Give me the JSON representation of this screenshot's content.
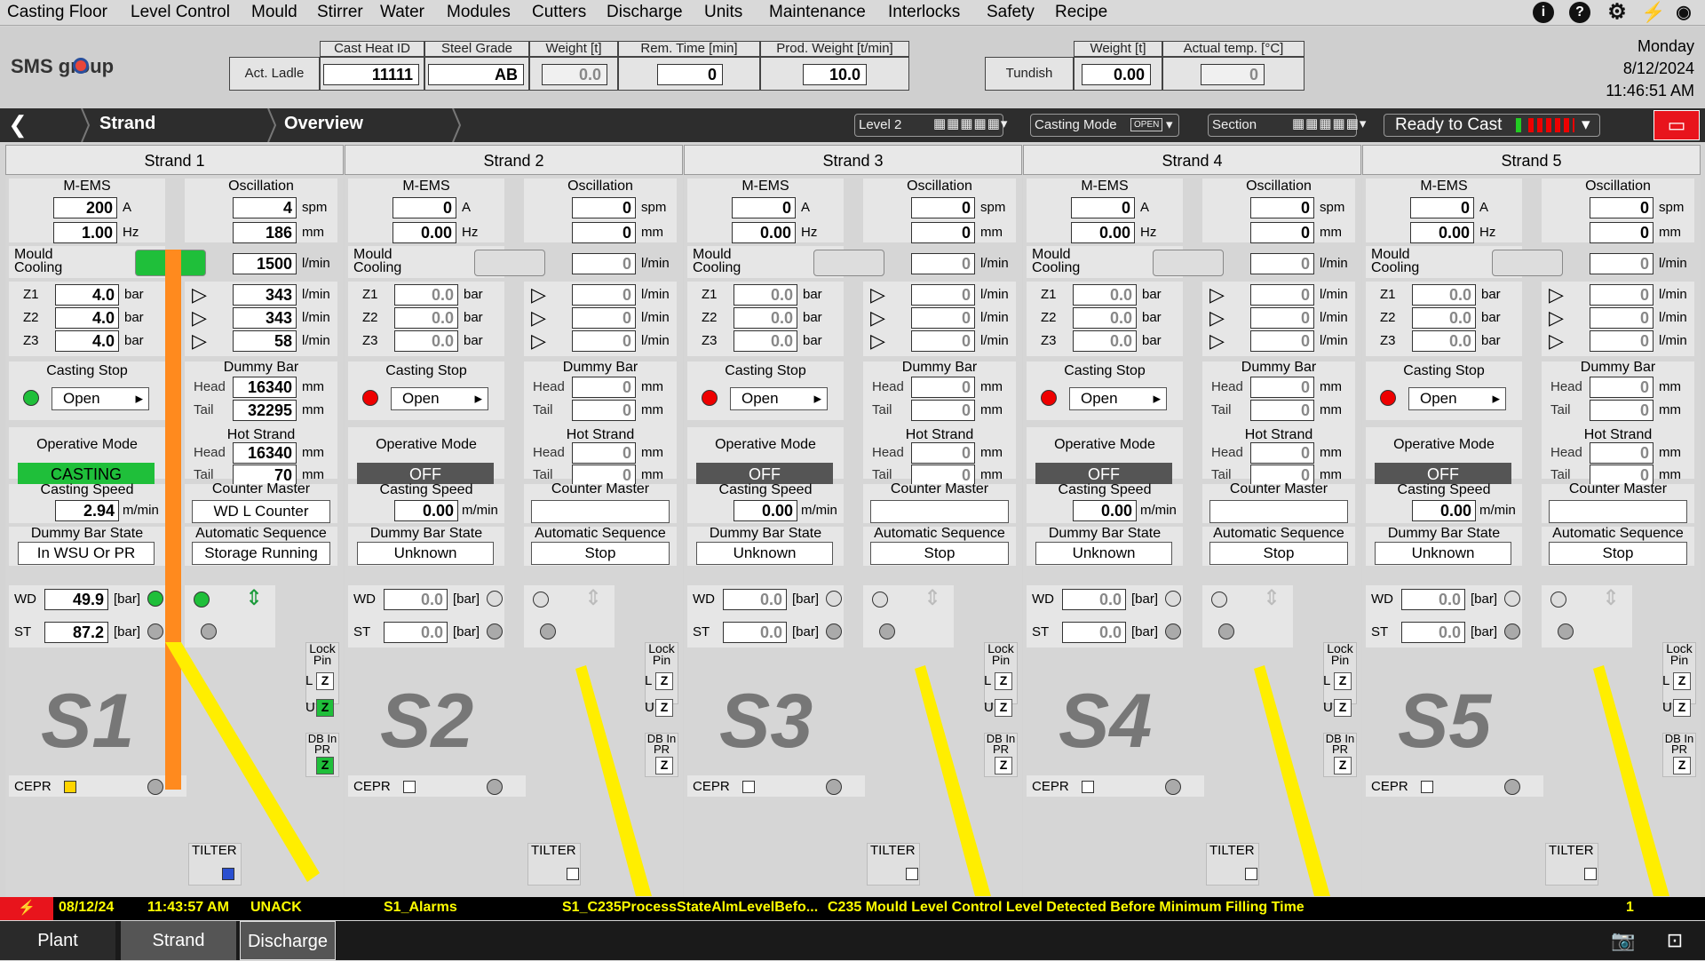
{
  "menu": [
    "Casting Floor",
    "Level Control",
    "Mould",
    "Stirrer",
    "Water",
    "Modules",
    "Cutters",
    "Discharge",
    "Units",
    "Maintenance",
    "Interlocks",
    "Safety",
    "Recipe"
  ],
  "logo": "SMS group",
  "ladle": {
    "row_label": "Act. Ladle",
    "h_heat": "Cast Heat ID",
    "h_grade": "Steel Grade",
    "h_weight": "Weight [t]",
    "h_rem": "Rem. Time [min]",
    "h_prod": "Prod. Weight [t/min]",
    "heat": "11111",
    "grade": "AB",
    "weight": "0.0",
    "rem": "0",
    "prod": "10.0"
  },
  "tundish": {
    "row_label": "Tundish",
    "h_weight": "Weight [t]",
    "h_temp": "Actual temp. [°C]",
    "weight": "0.00",
    "temp": "0"
  },
  "clock": {
    "day": "Monday",
    "date": "8/12/2024",
    "time": "11:46:51 AM"
  },
  "nav": {
    "strand": "Strand",
    "overview": "Overview",
    "level": "Level 2",
    "casting_mode": "Casting Mode",
    "open_badge": "OPEN",
    "section": "Section",
    "ready": "Ready to Cast"
  },
  "labels": {
    "mems": "M-EMS",
    "osc": "Oscillation",
    "mould_cooling": "Mould Cooling",
    "casting_stop": "Casting Stop",
    "dummy_bar": "Dummy Bar",
    "hot_strand": "Hot Strand",
    "head": "Head",
    "tail": "Tail",
    "operative_mode": "Operative Mode",
    "casting_speed": "Casting Speed",
    "counter_master": "Counter Master",
    "db_state": "Dummy Bar State",
    "auto_seq": "Automatic Sequence",
    "wd": "WD",
    "st": "ST",
    "cepr": "CEPR",
    "tilter": "TILTER",
    "lock_pin": "Lock Pin",
    "db_in_pr": "DB In PR",
    "u_a": "A",
    "u_hz": "Hz",
    "u_spm": "spm",
    "u_mm": "mm",
    "u_lmin": "l/min",
    "u_bar": "bar",
    "u_bbar": "[bar]",
    "u_mmin": "m/min",
    "z1": "Z1",
    "z2": "Z2",
    "z3": "Z3",
    "l": "L",
    "u": "U"
  },
  "strands": [
    {
      "name": "Strand 1",
      "big": "S1",
      "mems_a": "200",
      "mems_hz": "1.00",
      "osc_spm": "4",
      "osc_mm": "186",
      "mould_flow": "1500",
      "z1": "4.0",
      "z2": "4.0",
      "z3": "4.0",
      "z1f": "343",
      "z2f": "343",
      "z3f": "58",
      "stop": "Open",
      "db_head": "16340",
      "db_tail": "32295",
      "hs_head": "16340",
      "hs_tail": "70",
      "mode": "CASTING",
      "speed": "2.94",
      "counter": "WD L Counter",
      "db_state": "In WSU Or PR",
      "seq": "Storage Running",
      "wd": "49.9",
      "st": "87.2"
    },
    {
      "name": "Strand 2",
      "big": "S2",
      "mems_a": "0",
      "mems_hz": "0.00",
      "osc_spm": "0",
      "osc_mm": "0",
      "mould_flow": "0",
      "z1": "0.0",
      "z2": "0.0",
      "z3": "0.0",
      "z1f": "0",
      "z2f": "0",
      "z3f": "0",
      "stop": "Open",
      "db_head": "0",
      "db_tail": "0",
      "hs_head": "0",
      "hs_tail": "0",
      "mode": "OFF",
      "speed": "0.00",
      "counter": "",
      "db_state": "Unknown",
      "seq": "Stop",
      "wd": "0.0",
      "st": "0.0"
    },
    {
      "name": "Strand 3",
      "big": "S3",
      "mems_a": "0",
      "mems_hz": "0.00",
      "osc_spm": "0",
      "osc_mm": "0",
      "mould_flow": "0",
      "z1": "0.0",
      "z2": "0.0",
      "z3": "0.0",
      "z1f": "0",
      "z2f": "0",
      "z3f": "0",
      "stop": "Open",
      "db_head": "0",
      "db_tail": "0",
      "hs_head": "0",
      "hs_tail": "0",
      "mode": "OFF",
      "speed": "0.00",
      "counter": "",
      "db_state": "Unknown",
      "seq": "Stop",
      "wd": "0.0",
      "st": "0.0"
    },
    {
      "name": "Strand 4",
      "big": "S4",
      "mems_a": "0",
      "mems_hz": "0.00",
      "osc_spm": "0",
      "osc_mm": "0",
      "mould_flow": "0",
      "z1": "0.0",
      "z2": "0.0",
      "z3": "0.0",
      "z1f": "0",
      "z2f": "0",
      "z3f": "0",
      "stop": "Open",
      "db_head": "0",
      "db_tail": "0",
      "hs_head": "0",
      "hs_tail": "0",
      "mode": "OFF",
      "speed": "0.00",
      "counter": "",
      "db_state": "Unknown",
      "seq": "Stop",
      "wd": "0.0",
      "st": "0.0"
    },
    {
      "name": "Strand 5",
      "big": "S5",
      "mems_a": "0",
      "mems_hz": "0.00",
      "osc_spm": "0",
      "osc_mm": "0",
      "mould_flow": "0",
      "z1": "0.0",
      "z2": "0.0",
      "z3": "0.0",
      "z1f": "0",
      "z2f": "0",
      "z3f": "0",
      "stop": "Open",
      "db_head": "0",
      "db_tail": "0",
      "hs_head": "0",
      "hs_tail": "0",
      "mode": "OFF",
      "speed": "0.00",
      "counter": "",
      "db_state": "Unknown",
      "seq": "Stop",
      "wd": "0.0",
      "st": "0.0"
    }
  ],
  "alarm": {
    "date": "08/12/24",
    "time": "11:43:57 AM",
    "state": "UNACK",
    "group": "S1_Alarms",
    "tag": "S1_C235ProcessStateAlmLevelBefo...",
    "text": "C235 Mould Level Control Level Detected Before Minimum Filling Time",
    "count": "1"
  },
  "tabs": [
    "Plant",
    "Strand",
    "Discharge"
  ],
  "colors": {
    "casting": "#1fbf3a",
    "off": "#555555",
    "strand_orange": "#ff8a1e",
    "strand_yellow": "#ffee00",
    "alarm_text": "#ffee00"
  }
}
